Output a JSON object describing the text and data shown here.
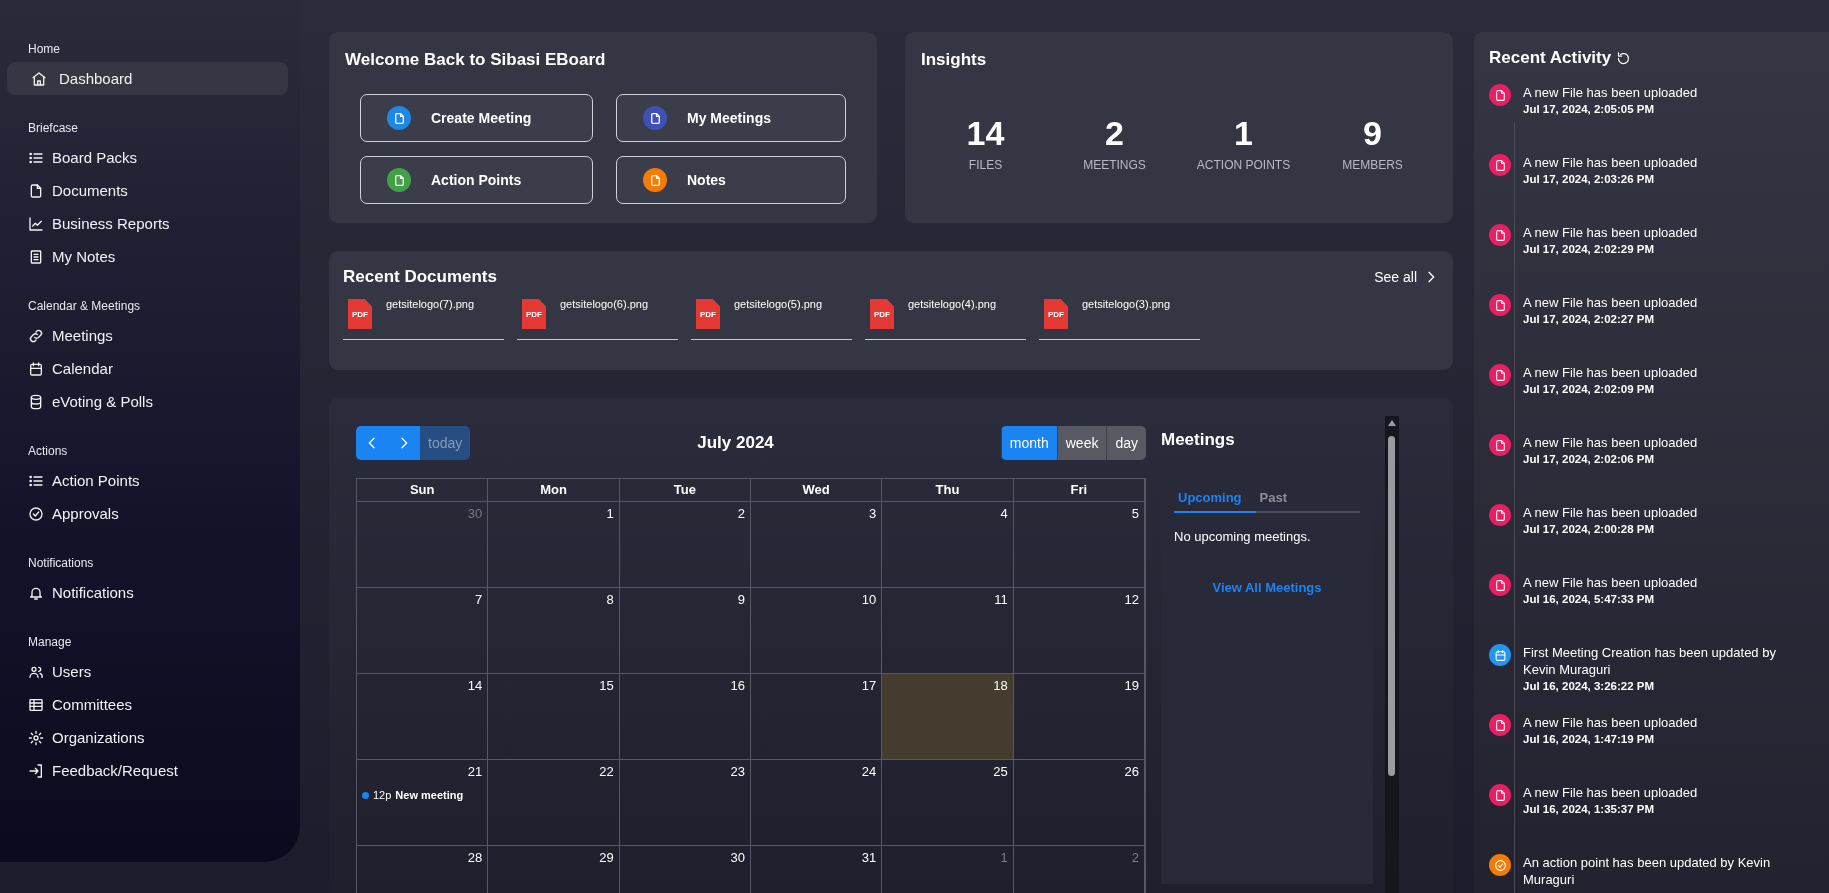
{
  "sidebar": {
    "sections": [
      {
        "title": "Home",
        "items": [
          {
            "label": "Dashboard",
            "selected": true
          }
        ]
      },
      {
        "title": "Briefcase",
        "items": [
          {
            "label": "Board Packs",
            "selected": false
          },
          {
            "label": "Documents",
            "selected": false
          },
          {
            "label": "Business Reports",
            "selected": false
          },
          {
            "label": "My Notes",
            "selected": false
          }
        ]
      },
      {
        "title": "Calendar & Meetings",
        "items": [
          {
            "label": "Meetings",
            "selected": false
          },
          {
            "label": "Calendar",
            "selected": false
          },
          {
            "label": "eVoting & Polls",
            "selected": false
          }
        ]
      },
      {
        "title": "Actions",
        "items": [
          {
            "label": "Action Points",
            "selected": false
          },
          {
            "label": "Approvals",
            "selected": false
          }
        ]
      },
      {
        "title": "Notifications",
        "items": [
          {
            "label": "Notifications",
            "selected": false
          }
        ]
      },
      {
        "title": "Manage",
        "items": [
          {
            "label": "Users",
            "selected": false
          },
          {
            "label": "Committees",
            "selected": false
          },
          {
            "label": "Organizations",
            "selected": false
          },
          {
            "label": "Feedback/Request",
            "selected": false
          }
        ]
      }
    ]
  },
  "welcome": {
    "title": "Welcome Back to Sibasi EBoard",
    "actions": [
      {
        "label": "Create Meeting",
        "color": "#1e88e5"
      },
      {
        "label": "My Meetings",
        "color": "#3f51b5"
      },
      {
        "label": "Action Points",
        "color": "#43a047"
      },
      {
        "label": "Notes",
        "color": "#f57c00"
      }
    ]
  },
  "insights": {
    "title": "Insights",
    "stats": [
      {
        "value": "14",
        "label": "FILES"
      },
      {
        "value": "2",
        "label": "MEETINGS"
      },
      {
        "value": "1",
        "label": "ACTION POINTS"
      },
      {
        "value": "9",
        "label": "MEMBERS"
      }
    ]
  },
  "recent_documents": {
    "title": "Recent Documents",
    "see_all": "See all",
    "files": [
      {
        "badge": "PDF",
        "name": "getsitelogo(7).png"
      },
      {
        "badge": "PDF",
        "name": "getsitelogo(6).png"
      },
      {
        "badge": "PDF",
        "name": "getsitelogo(5).png"
      },
      {
        "badge": "PDF",
        "name": "getsitelogo(4).png"
      },
      {
        "badge": "PDF",
        "name": "getsitelogo(3).png"
      }
    ]
  },
  "calendar": {
    "title": "July 2024",
    "today_button": {
      "label": "today",
      "disabled": true
    },
    "views": [
      {
        "label": "month",
        "selected": true
      },
      {
        "label": "week",
        "selected": false
      },
      {
        "label": "day",
        "selected": false
      }
    ],
    "weekdays": [
      "Sun",
      "Mon",
      "Tue",
      "Wed",
      "Thu",
      "Fri"
    ],
    "weeks": [
      [
        {
          "day": "30",
          "other_month": true,
          "today": false
        },
        {
          "day": "1",
          "other_month": false,
          "today": false
        },
        {
          "day": "2",
          "other_month": false,
          "today": false
        },
        {
          "day": "3",
          "other_month": false,
          "today": false
        },
        {
          "day": "4",
          "other_month": false,
          "today": false
        },
        {
          "day": "5",
          "other_month": false,
          "today": false
        }
      ],
      [
        {
          "day": "7",
          "other_month": false,
          "today": false
        },
        {
          "day": "8",
          "other_month": false,
          "today": false
        },
        {
          "day": "9",
          "other_month": false,
          "today": false
        },
        {
          "day": "10",
          "other_month": false,
          "today": false
        },
        {
          "day": "11",
          "other_month": false,
          "today": false
        },
        {
          "day": "12",
          "other_month": false,
          "today": false
        }
      ],
      [
        {
          "day": "14",
          "other_month": false,
          "today": false
        },
        {
          "day": "15",
          "other_month": false,
          "today": false
        },
        {
          "day": "16",
          "other_month": false,
          "today": false
        },
        {
          "day": "17",
          "other_month": false,
          "today": false
        },
        {
          "day": "18",
          "other_month": false,
          "today": true
        },
        {
          "day": "19",
          "other_month": false,
          "today": false
        }
      ],
      [
        {
          "day": "21",
          "other_month": false,
          "today": false,
          "events": [
            {
              "time": "12p",
              "title": "New meeting"
            }
          ]
        },
        {
          "day": "22",
          "other_month": false,
          "today": false
        },
        {
          "day": "23",
          "other_month": false,
          "today": false
        },
        {
          "day": "24",
          "other_month": false,
          "today": false
        },
        {
          "day": "25",
          "other_month": false,
          "today": false
        },
        {
          "day": "26",
          "other_month": false,
          "today": false
        }
      ],
      [
        {
          "day": "28",
          "other_month": false,
          "today": false
        },
        {
          "day": "29",
          "other_month": false,
          "today": false
        },
        {
          "day": "30",
          "other_month": false,
          "today": false
        },
        {
          "day": "31",
          "other_month": false,
          "today": false
        },
        {
          "day": "1",
          "other_month": true,
          "today": false
        },
        {
          "day": "2",
          "other_month": true,
          "today": false
        }
      ]
    ]
  },
  "meetings": {
    "title": "Meetings",
    "tabs": [
      {
        "label": "Upcoming",
        "selected": true
      },
      {
        "label": "Past",
        "selected": false
      }
    ],
    "empty_text": "No upcoming meetings.",
    "view_all": "View All Meetings"
  },
  "recent_activity": {
    "title": "Recent Activity",
    "items": [
      {
        "kind": "file",
        "text": "A new File has been uploaded",
        "time": "Jul 17, 2024, 2:05:05 PM"
      },
      {
        "kind": "file",
        "text": "A new File has been uploaded",
        "time": "Jul 17, 2024, 2:03:26 PM"
      },
      {
        "kind": "file",
        "text": "A new File has been uploaded",
        "time": "Jul 17, 2024, 2:02:29 PM"
      },
      {
        "kind": "file",
        "text": "A new File has been uploaded",
        "time": "Jul 17, 2024, 2:02:27 PM"
      },
      {
        "kind": "file",
        "text": "A new File has been uploaded",
        "time": "Jul 17, 2024, 2:02:09 PM"
      },
      {
        "kind": "file",
        "text": "A new File has been uploaded",
        "time": "Jul 17, 2024, 2:02:06 PM"
      },
      {
        "kind": "file",
        "text": "A new File has been uploaded",
        "time": "Jul 17, 2024, 2:00:28 PM"
      },
      {
        "kind": "file",
        "text": "A new File has been uploaded",
        "time": "Jul 16, 2024, 5:47:33 PM"
      },
      {
        "kind": "meeting",
        "text": "First Meeting Creation has been updated by Kevin Muraguri",
        "time": "Jul 16, 2024, 3:26:22 PM"
      },
      {
        "kind": "file",
        "text": "A new File has been uploaded",
        "time": "Jul 16, 2024, 1:47:19 PM"
      },
      {
        "kind": "file",
        "text": "A new File has been uploaded",
        "time": "Jul 16, 2024, 1:35:37 PM"
      },
      {
        "kind": "action",
        "text": "An action point has been updated by Kevin Muraguri"
      }
    ]
  }
}
